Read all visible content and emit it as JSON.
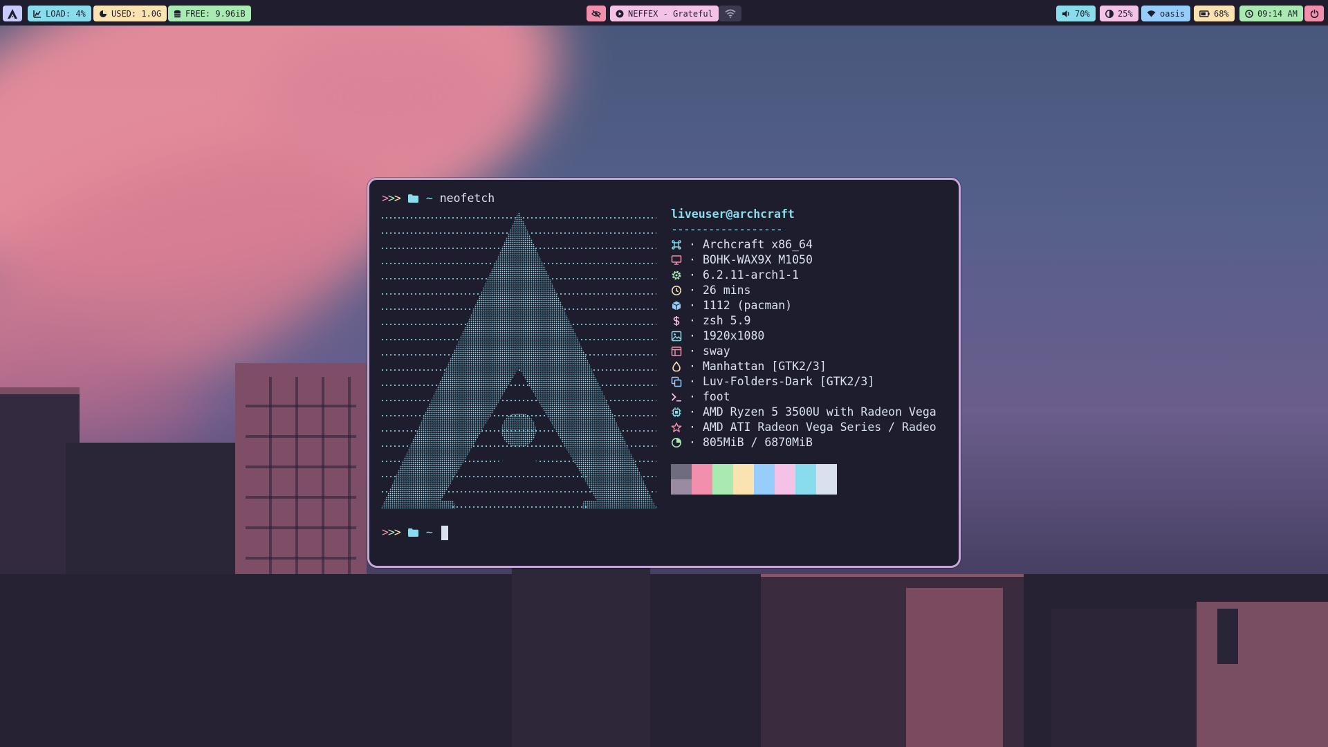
{
  "topbar": {
    "launcher_icon": "archcraft-logo-icon",
    "load": "LOAD: 4%",
    "used": "USED: 1.0G",
    "free": "FREE: 9.96iB",
    "music_toggle_icon": "eye-slash-icon",
    "music": "NEFFEX - Grateful",
    "network_icon": "wifi-icon",
    "volume": "70%",
    "brightness": "25%",
    "wifi": "oasis",
    "battery": "68%",
    "clock": "09:14 AM",
    "power_icon": "power-icon"
  },
  "terminal": {
    "prompt_arrows": ">>>",
    "prompt_dir": "~",
    "command": "neofetch",
    "userhost": "liveuser@archcraft",
    "underline": "------------------",
    "rows": [
      {
        "icon": "command-icon",
        "color": "#89dceb",
        "value": "Archcraft x86_64"
      },
      {
        "icon": "monitor-icon",
        "color": "#f28fad",
        "value": "BOHK-WAX9X M1050"
      },
      {
        "icon": "gear-icon",
        "color": "#abe9b3",
        "value": "6.2.11-arch1-1"
      },
      {
        "icon": "clock-icon",
        "color": "#fae3b0",
        "value": "26 mins"
      },
      {
        "icon": "package-icon",
        "color": "#96cdfb",
        "value": "1112 (pacman)"
      },
      {
        "icon": "dollar-icon",
        "color": "#f5c2e7",
        "value": "zsh 5.9"
      },
      {
        "icon": "image-icon",
        "color": "#89dceb",
        "value": "1920x1080"
      },
      {
        "icon": "window-icon",
        "color": "#f28fad",
        "value": "sway"
      },
      {
        "icon": "drop-icon",
        "color": "#fae3b0",
        "value": "Manhattan [GTK2/3]"
      },
      {
        "icon": "copy-icon",
        "color": "#96cdfb",
        "value": "Luv-Folders-Dark [GTK2/3]"
      },
      {
        "icon": "terminal-icon",
        "color": "#f5c2e7",
        "value": "foot"
      },
      {
        "icon": "cpu-icon",
        "color": "#89dceb",
        "value": "AMD Ryzen 5 3500U with Radeon Vega"
      },
      {
        "icon": "star-icon",
        "color": "#f28fad",
        "value": "AMD ATI Radeon Vega Series / Radeo"
      },
      {
        "icon": "pie-icon",
        "color": "#abe9b3",
        "value": "805MiB / 6870MiB"
      }
    ],
    "palette": [
      {
        "top": "#6e6c7e",
        "bottom": "#988ba2"
      },
      {
        "top": "#f28fad",
        "bottom": "#f28fad"
      },
      {
        "top": "#abe9b3",
        "bottom": "#abe9b3"
      },
      {
        "top": "#fae3b0",
        "bottom": "#fae3b0"
      },
      {
        "top": "#96cdfb",
        "bottom": "#96cdfb"
      },
      {
        "top": "#f5c2e7",
        "bottom": "#f5c2e7"
      },
      {
        "top": "#89dceb",
        "bottom": "#89dceb"
      },
      {
        "top": "#d9e0ee",
        "bottom": "#d9e0ee"
      }
    ]
  },
  "colors": {
    "bar_bg": "#1f1d2e",
    "terminal_bg": "#1e1d2d",
    "terminal_border": "#c5a8d8",
    "cyan": "#89dceb",
    "pink": "#f28fad",
    "green": "#abe9b3",
    "yellow": "#fae3b0",
    "blue": "#96cdfb",
    "magenta": "#f5c2e7"
  }
}
